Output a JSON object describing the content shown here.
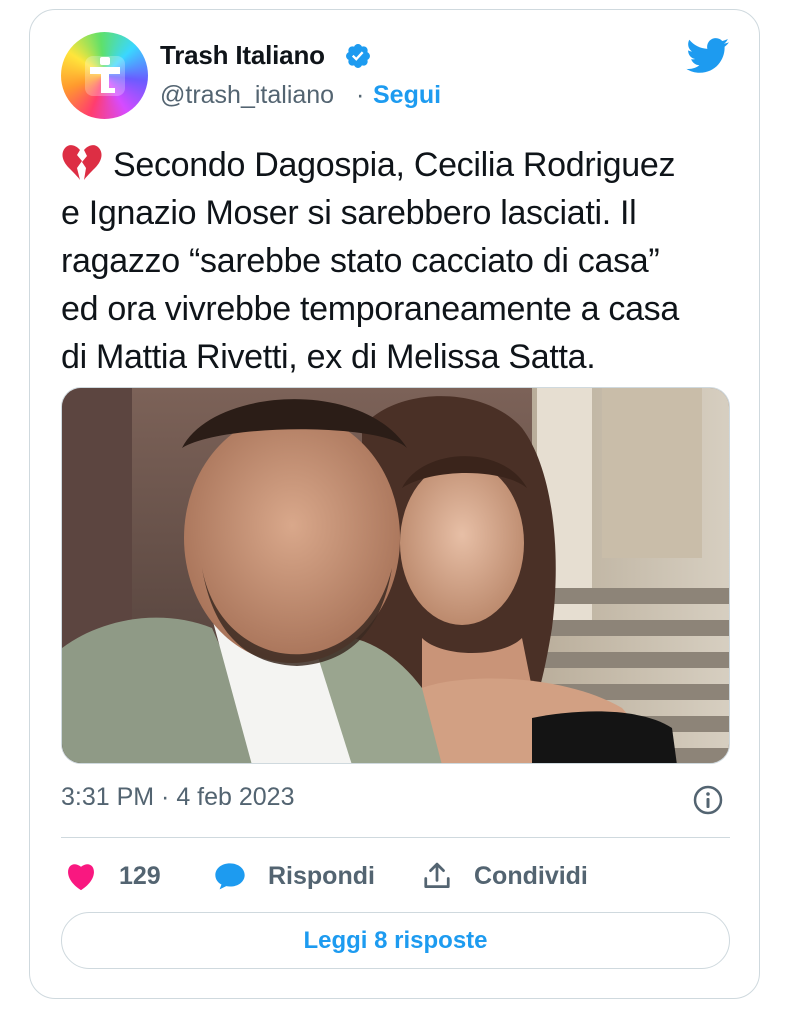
{
  "author": {
    "name": "Trash Italiano",
    "handle": "@trash_italiano",
    "separator": "·",
    "follow_label": "Segui",
    "avatar_icon": "letter-t-logo"
  },
  "tweet": {
    "emoji": "broken-heart",
    "text": "Secondo Dagospia, Cecilia Rodriguez\ne Ignazio Moser si sarebbero lasciati. Il\nragazzo “sarebbe stato cacciato di casa”\ned ora vivrebbe temporaneamente a casa\ndi Mattia Rivetti, ex di Melissa Satta.",
    "timestamp": "3:31 PM · 4 feb 2023"
  },
  "actions": {
    "like_count": "129",
    "reply_label": "Rispondi",
    "share_label": "Condividi"
  },
  "read_replies_label": "Leggi 8 risposte",
  "colors": {
    "accent": "#1d9bf0",
    "like": "#f91880",
    "text": "#0f1419",
    "muted": "#536471",
    "border": "#cfd9de"
  }
}
